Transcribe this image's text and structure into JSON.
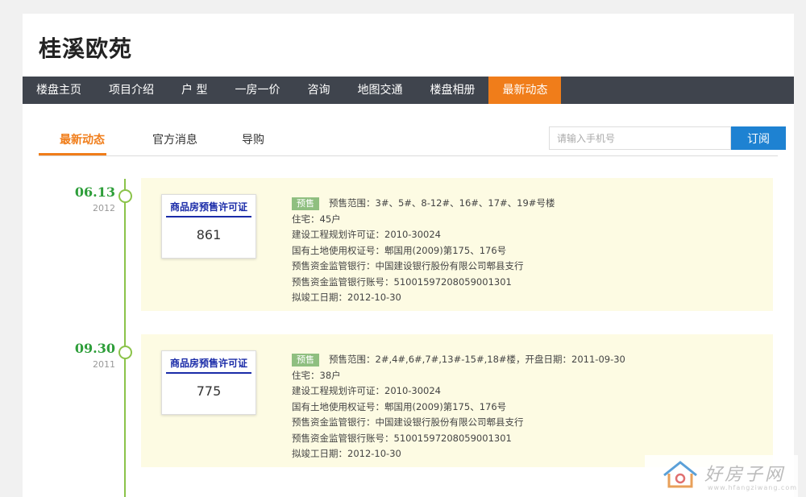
{
  "page_title": "桂溪欧苑",
  "nav": {
    "items": [
      {
        "label": "楼盘主页"
      },
      {
        "label": "项目介绍"
      },
      {
        "label": "户 型"
      },
      {
        "label": "一房一价"
      },
      {
        "label": "咨询"
      },
      {
        "label": "地图交通"
      },
      {
        "label": "楼盘相册"
      },
      {
        "label": "最新动态"
      }
    ],
    "active": "最新动态"
  },
  "tabs": [
    {
      "label": "最新动态"
    },
    {
      "label": "官方消息"
    },
    {
      "label": "导购"
    }
  ],
  "subscribe": {
    "placeholder": "请输入手机号",
    "button": "订阅"
  },
  "timeline": [
    {
      "date": "06.13",
      "year": "2012",
      "cert_title": "商品房预售许可证",
      "cert_number": "861",
      "badge": "预售",
      "range": "预售范围：3#、5#、8-12#、16#、17#、19#号楼",
      "residential": "住宅：45户",
      "planning_permit": "建设工程规划许可证：2010-30024",
      "land_cert": "国有土地使用权证号：郫国用(2009)第175、176号",
      "bank": "预售资金监管银行：中国建设银行股份有限公司郫县支行",
      "account": "预售资金监管银行账号：51001597208059001301",
      "completion": "拟竣工日期：2012-10-30"
    },
    {
      "date": "09.30",
      "year": "2011",
      "cert_title": "商品房预售许可证",
      "cert_number": "775",
      "badge": "预售",
      "range": "预售范围：2#,4#,6#,7#,13#-15#,18#楼，开盘日期：2011-09-30",
      "residential": "住宅：38户",
      "planning_permit": "建设工程规划许可证：2010-30024",
      "land_cert": "国有土地使用权证号：郫国用(2009)第175、176号",
      "bank": "预售资金监管银行：中国建设银行股份有限公司郫县支行",
      "account": "预售资金监管银行账号：51001597208059001301",
      "completion": "拟竣工日期：2012-10-30"
    }
  ],
  "watermark": {
    "text": "好房子网",
    "url": "www.hfangziwang.com",
    "icon": "house-logo-icon"
  },
  "colors": {
    "nav_bg": "#3f444d",
    "accent": "#f07d1a",
    "timeline_green": "#2e9e3a",
    "cert_blue": "#1a2ba8",
    "subscribe_blue": "#1e82d2",
    "entry_bg": "#fdfbe3"
  }
}
